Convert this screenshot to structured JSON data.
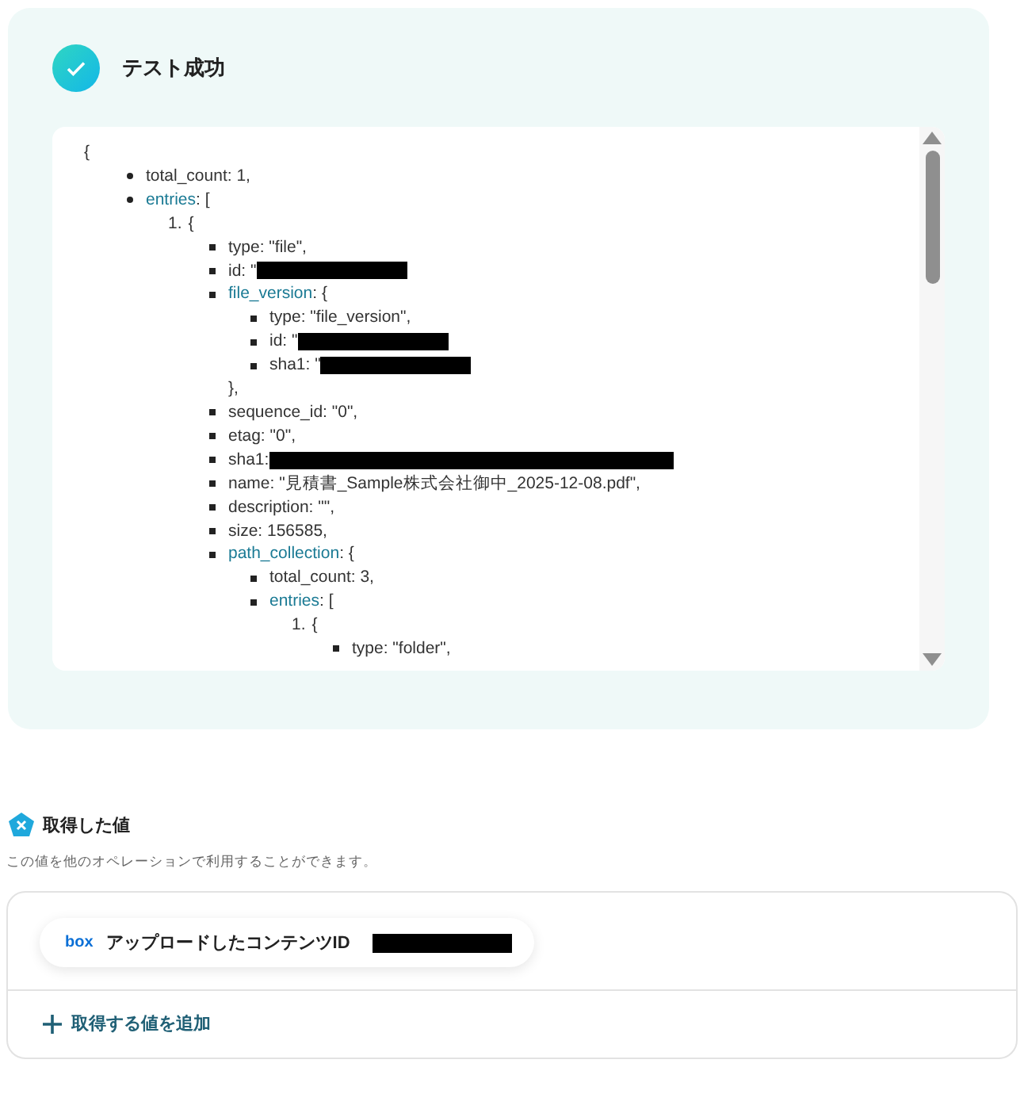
{
  "result": {
    "title": "テスト成功",
    "open": "{",
    "items": [
      {
        "text": "total_count: 1,"
      },
      {
        "key": "entries",
        "text": ": [",
        "children": [
          {
            "marker": "1.",
            "text": "{",
            "children": [
              {
                "text": "type: \"file\","
              },
              {
                "text": "id: \"",
                "redacted": true
              },
              {
                "key": "file_version",
                "text": ": {",
                "close": "},",
                "children": [
                  {
                    "text": "type: \"file_version\","
                  },
                  {
                    "text": "id: \"",
                    "redacted": true
                  },
                  {
                    "text": "sha1: \"",
                    "redacted": true
                  }
                ]
              },
              {
                "text": "sequence_id: \"0\","
              },
              {
                "text": "etag: \"0\","
              },
              {
                "text": "sha1: ",
                "redacted": true
              },
              {
                "text": "name: \"見積書_Sample株式会社御中_2025-12-08.pdf\","
              },
              {
                "text": "description: \"\","
              },
              {
                "text": "size: 156585,"
              },
              {
                "key": "path_collection",
                "text": ": {",
                "children": [
                  {
                    "text": "total_count: 3,"
                  },
                  {
                    "key": "entries",
                    "text": ": [",
                    "children": [
                      {
                        "marker": "1.",
                        "text": "{",
                        "children": [
                          {
                            "text": "type: \"folder\","
                          }
                        ]
                      }
                    ]
                  }
                ]
              }
            ]
          }
        ]
      }
    ]
  },
  "values": {
    "title": "取得した値",
    "description": "この値を他のオペレーションで利用することができます。",
    "items": [
      {
        "logo": "box",
        "label": "アップロードしたコンテンツID",
        "redacted": true
      }
    ],
    "add_button": "取得する値を追加"
  }
}
